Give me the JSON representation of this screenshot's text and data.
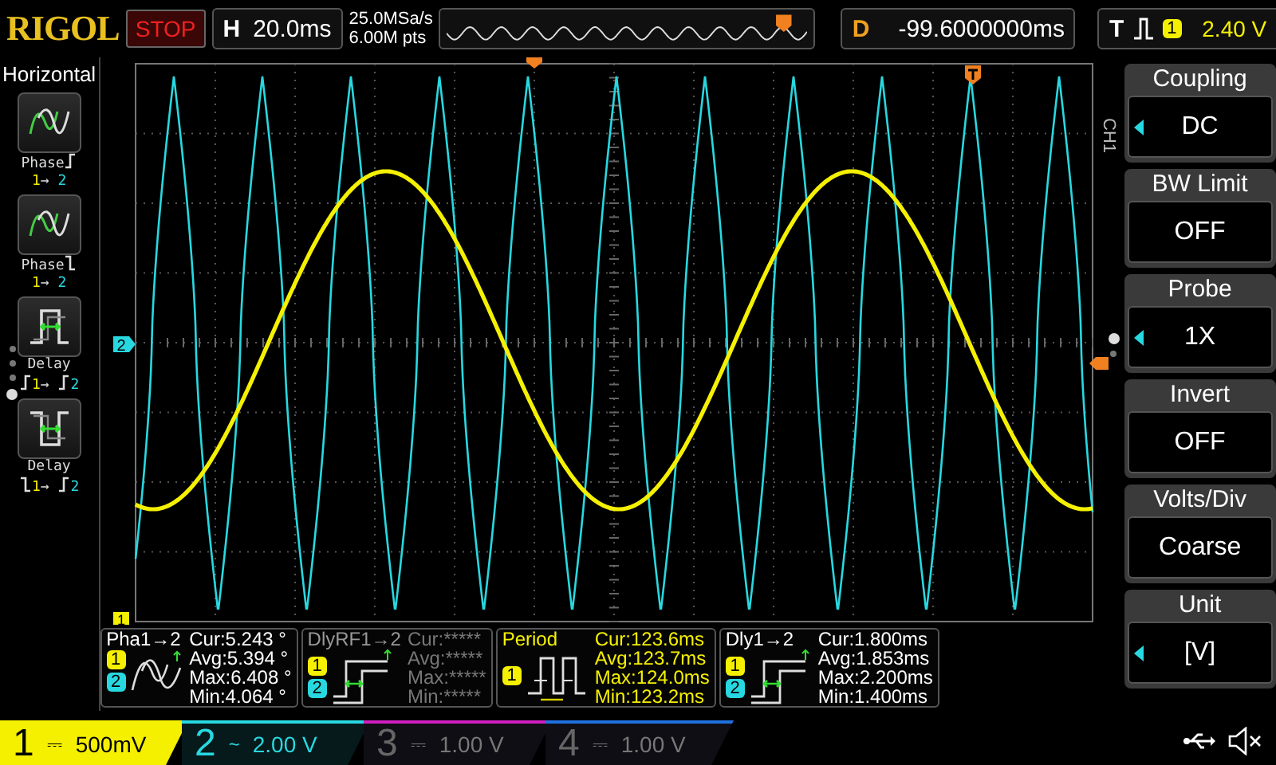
{
  "top_bar": {
    "logo": "RIGOL",
    "run_state": "STOP",
    "timebase": {
      "label": "H",
      "value": "20.0ms"
    },
    "sample_rate": "25.0MSa/s",
    "memory_depth": "6.00M pts",
    "delay": {
      "label": "D",
      "value": "-99.6000000ms"
    },
    "trigger": {
      "label": "T",
      "source": "1",
      "level": "2.40 V"
    }
  },
  "horizontal_menu": {
    "title": "Horizontal",
    "items": [
      {
        "kind": "phase-rise",
        "label": "Phase",
        "from": "1",
        "arrow": "→",
        "to": "2"
      },
      {
        "kind": "phase-fall",
        "label": "Phase",
        "from": "1",
        "arrow": "→",
        "to": "2"
      },
      {
        "kind": "delay-rise",
        "label": "Delay",
        "from": "1",
        "arrow": "→",
        "to": "2"
      },
      {
        "kind": "delay-fall",
        "label": "Delay",
        "from": "1",
        "arrow": "→",
        "to": "2"
      }
    ],
    "pages": [
      {
        "selected": false
      },
      {
        "selected": false
      },
      {
        "selected": false
      },
      {
        "selected": true
      }
    ]
  },
  "screen": {
    "channel_label": "CH1",
    "channel_markers": [
      {
        "label": "2"
      },
      {
        "label": "1"
      }
    ]
  },
  "measurements": [
    {
      "title": "Pha1→2",
      "sources": [
        "1",
        "2"
      ],
      "kind": "phase",
      "values": [
        "Cur:5.243 °",
        "Avg:5.394 °",
        "Max:6.408 °",
        "Min:4.064 °"
      ],
      "valid": true
    },
    {
      "title": "DlyRF1→2",
      "sources": [
        "1",
        "2"
      ],
      "kind": "delay",
      "values": [
        "Cur:*****",
        "Avg:*****",
        "Max:*****",
        "Min:*****"
      ],
      "valid": false
    },
    {
      "title": "Period",
      "sources": [
        "1"
      ],
      "kind": "period",
      "values": [
        "Cur:123.6ms",
        "Avg:123.7ms",
        "Max:124.0ms",
        "Min:123.2ms"
      ],
      "valid": true
    },
    {
      "title": "Dly1→2",
      "sources": [
        "1",
        "2"
      ],
      "kind": "delay",
      "values": [
        "Cur:1.800ms",
        "Avg:1.853ms",
        "Max:2.200ms",
        "Min:1.400ms"
      ],
      "valid": true
    }
  ],
  "channel_menu": {
    "items": [
      {
        "title": "Coupling",
        "value": "DC",
        "adjustable": true
      },
      {
        "title": "BW Limit",
        "value": "OFF",
        "adjustable": false
      },
      {
        "title": "Probe",
        "value": "1X",
        "adjustable": true
      },
      {
        "title": "Invert",
        "value": "OFF",
        "adjustable": false
      },
      {
        "title": "Volts/Div",
        "value": "Coarse",
        "adjustable": false
      },
      {
        "title": "Unit",
        "value": "[V]",
        "adjustable": true
      }
    ],
    "pages": [
      {
        "selected": true
      },
      {
        "selected": false
      }
    ]
  },
  "channels": [
    {
      "number": "1",
      "coupling": "⎓",
      "scale": "500mV",
      "on": true,
      "selected": true,
      "color": "#f5f000"
    },
    {
      "number": "2",
      "coupling": "~",
      "scale": "2.00 V",
      "on": true,
      "selected": false,
      "color": "#28d8e0"
    },
    {
      "number": "3",
      "coupling": "⎓",
      "scale": "1.00 V",
      "on": false,
      "selected": false,
      "color": "#d020c0"
    },
    {
      "number": "4",
      "coupling": "⎓",
      "scale": "1.00 V",
      "on": false,
      "selected": false,
      "color": "#2070e0"
    }
  ]
}
